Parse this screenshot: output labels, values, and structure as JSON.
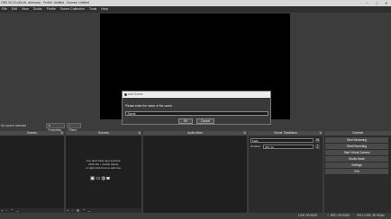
{
  "window": {
    "title": "OBS 30.0.0 (64-bit, windows) - Profile: Untitled - Scenes: Untitled",
    "controls": [
      "–",
      "□",
      "✕"
    ]
  },
  "menu": [
    "File",
    "Edit",
    "View",
    "Docks",
    "Profile",
    "Scene Collection",
    "Tools",
    "Help"
  ],
  "toolbar": {
    "no_source": "No source selected",
    "properties": "Properties",
    "filters": "Filters"
  },
  "docks": {
    "scenes": {
      "title": "Scenes",
      "foot_icons": [
        "+",
        "−",
        "⌃",
        "⌄"
      ]
    },
    "sources": {
      "title": "Sources",
      "hint_line1": "You don't have any sources.",
      "hint_line2": "Click the + button below,",
      "hint_line3": "or right click here to add one.",
      "foot_icons": [
        "+",
        "−",
        "⚙",
        "⌃",
        "⌄"
      ]
    },
    "mixer": {
      "title": "Audio Mixer"
    },
    "transitions": {
      "title": "Scene Transitions",
      "transition_value": "Fade",
      "duration_label": "Duration",
      "duration_value": "300 ms"
    },
    "controls": {
      "title": "Controls",
      "buttons": [
        "Start Streaming",
        "Start Recording",
        "Start Virtual Camera",
        "Studio Mode",
        "Settings",
        "Exit"
      ]
    }
  },
  "status": {
    "cpu": "CPU: 0.6%, 30.00 fps",
    "rec": "REC: 00:00:00",
    "live": "LIVE: 00:00:00"
  },
  "dialog": {
    "title": "Add Scene",
    "prompt": "Please enter the name of the scene",
    "input_value": "Scene",
    "ok_label": "OK",
    "cancel_label": "Cancel"
  }
}
